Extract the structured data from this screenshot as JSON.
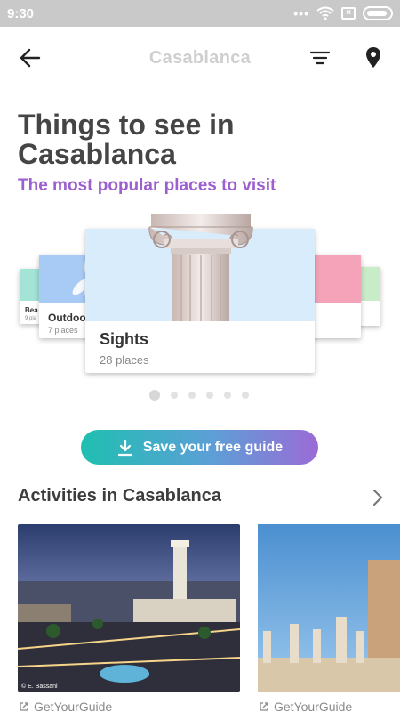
{
  "status_bar": {
    "time": "9:30",
    "icons": [
      "dots-icon",
      "wifi-icon",
      "sim-off-icon",
      "battery-icon"
    ]
  },
  "app_bar": {
    "title": "Casablanca",
    "back_icon": "arrow-left-icon",
    "filter_icon": "filter-icon",
    "map_icon": "location-pin-icon"
  },
  "header": {
    "title": "Things to see in Casablanca",
    "subtitle": "The most popular places to visit"
  },
  "carousel": {
    "cards": [
      {
        "label": "Bea",
        "sub": "9 pla"
      },
      {
        "label": "Outdoo",
        "sub": "7 places"
      },
      {
        "label": "Sights",
        "sub": "28 places"
      },
      {
        "label": "",
        "sub": ""
      },
      {
        "label": "",
        "sub": ""
      }
    ],
    "page_count": 6,
    "active_page": 0
  },
  "cta": {
    "label": "Save your free guide",
    "icon": "download-icon"
  },
  "activities": {
    "title": "Activities in Casablanca",
    "items": [
      {
        "provider": "GetYourGuide",
        "photo_credit": "© E. Bassani"
      },
      {
        "provider": "GetYourGuide"
      }
    ]
  },
  "colors": {
    "accent_purple": "#9b5fcf",
    "cta_gradient_start": "#1fbfb1",
    "cta_gradient_end": "#9b6bd6",
    "status_bar": "#c9c9c9"
  }
}
